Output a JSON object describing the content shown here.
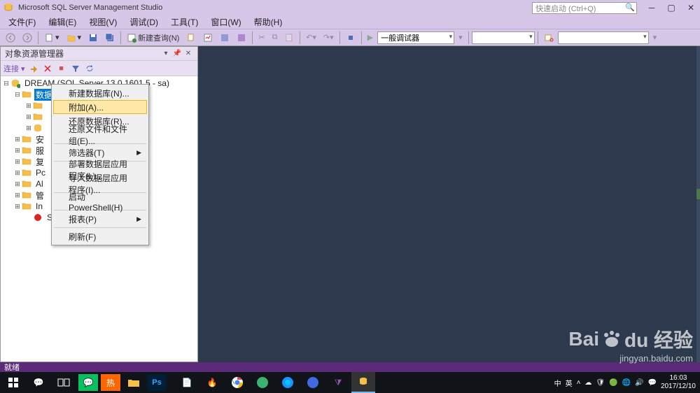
{
  "titlebar": {
    "app_title": "Microsoft SQL Server Management Studio",
    "quick_launch": "快速启动 (Ctrl+Q)"
  },
  "menubar": {
    "items": [
      "文件(F)",
      "编辑(E)",
      "视图(V)",
      "调试(D)",
      "工具(T)",
      "窗口(W)",
      "帮助(H)"
    ]
  },
  "toolbar": {
    "new_query": "新建查询(N)",
    "debug_mode": "一般调试器"
  },
  "panel": {
    "title": "对象资源管理器",
    "connect_label": "连接 ▾"
  },
  "tree": {
    "root": "DREAM (SQL Server 13.0.1601.5 - sa)",
    "selected_partial": "数据",
    "nodes": [
      "安",
      "服",
      "复",
      "Pc",
      "Al",
      "管",
      "In",
      "SC"
    ]
  },
  "context_menu": {
    "items": [
      {
        "label": "新建数据库(N)...",
        "hasSub": false
      },
      {
        "label": "附加(A)...",
        "hasSub": false,
        "hovered": true
      },
      {
        "label": "还原数据库(R)...",
        "hasSub": false
      },
      {
        "label": "还原文件和文件组(E)...",
        "hasSub": false
      },
      {
        "sep": true
      },
      {
        "label": "筛选器(T)",
        "hasSub": true
      },
      {
        "sep": true
      },
      {
        "label": "部署数据层应用程序(L)...",
        "hasSub": false
      },
      {
        "label": "导入数据层应用程序(I)...",
        "hasSub": false
      },
      {
        "sep": true
      },
      {
        "label": "启动 PowerShell(H)",
        "hasSub": false
      },
      {
        "sep": true
      },
      {
        "label": "报表(P)",
        "hasSub": true
      },
      {
        "sep": true
      },
      {
        "label": "刷新(F)",
        "hasSub": false
      }
    ]
  },
  "statusbar": {
    "text": "就绪"
  },
  "taskbar": {
    "ime1": "中",
    "ime2": "英",
    "clock_time": "16:03",
    "clock_date": "2017/12/10"
  },
  "watermark": {
    "brand": "Baidu 经验",
    "url": "jingyan.baidu.com"
  }
}
